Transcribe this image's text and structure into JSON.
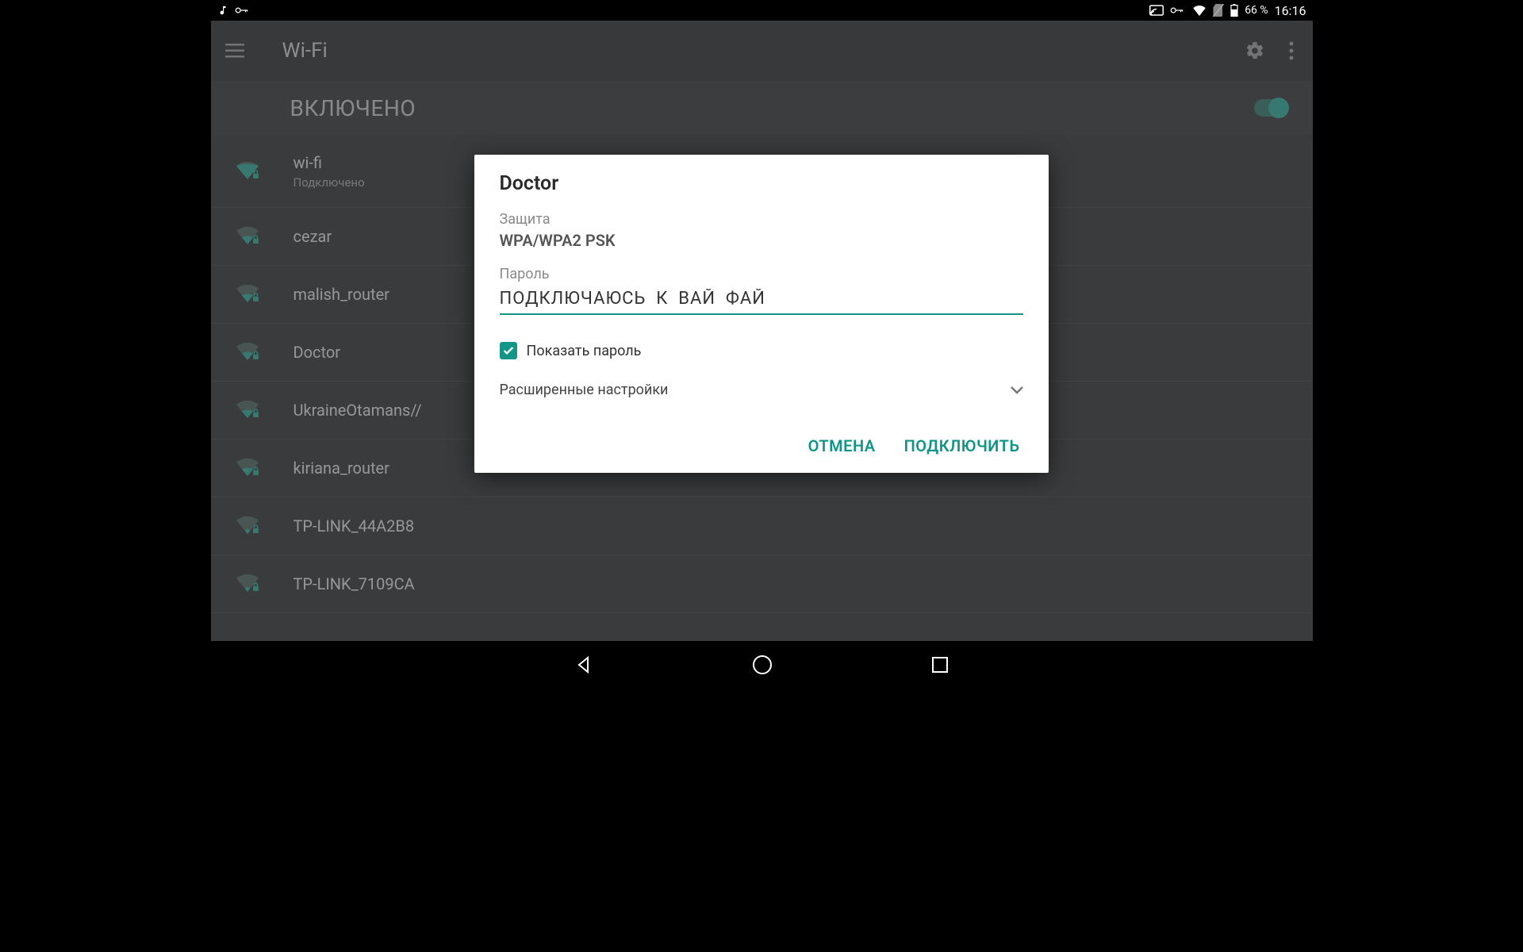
{
  "statusbar": {
    "battery_text": "66 %",
    "clock": "16:16"
  },
  "appbar": {
    "title": "Wi-Fi"
  },
  "togglebar": {
    "label": "ВКЛЮЧЕНО"
  },
  "networks": [
    {
      "ssid": "wi-fi",
      "sub": "Подключено",
      "locked": true,
      "strength": 4
    },
    {
      "ssid": "cezar",
      "sub": "",
      "locked": true,
      "strength": 2
    },
    {
      "ssid": "malish_router",
      "sub": "",
      "locked": true,
      "strength": 2
    },
    {
      "ssid": "Doctor",
      "sub": "",
      "locked": true,
      "strength": 2
    },
    {
      "ssid": "UkraineOtamans//",
      "sub": "",
      "locked": true,
      "strength": 2
    },
    {
      "ssid": "kiriana_router",
      "sub": "",
      "locked": true,
      "strength": 2
    },
    {
      "ssid": "TP-LINK_44A2B8",
      "sub": "",
      "locked": true,
      "strength": 1
    },
    {
      "ssid": "TP-LINK_7109CA",
      "sub": "",
      "locked": true,
      "strength": 1
    }
  ],
  "dialog": {
    "title": "Doctor",
    "security_label": "Защита",
    "security_value": "WPA/WPA2 PSK",
    "password_label": "Пароль",
    "password_value": "ПОДКЛЮЧАЮСЬ  К  ВАЙ  ФАЙ",
    "show_password_label": "Показать пароль",
    "show_password_checked": true,
    "advanced_label": "Расширенные настройки",
    "cancel": "ОТМЕНА",
    "connect": "ПОДКЛЮЧИТЬ"
  }
}
